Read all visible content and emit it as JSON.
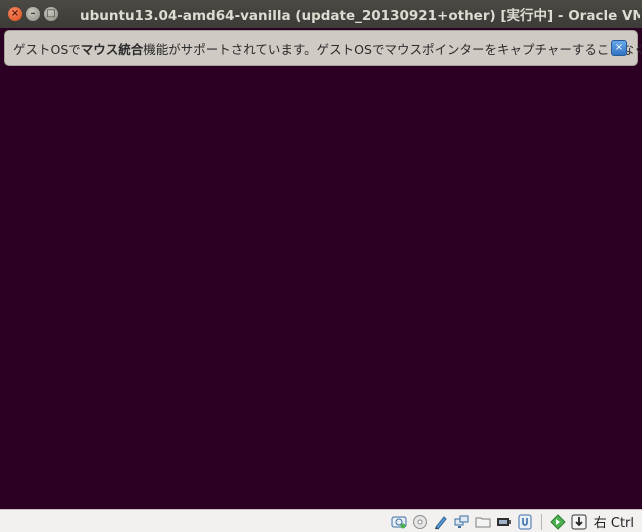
{
  "window": {
    "title": "ubuntu13.04-amd64-vanilla (update_20130921+other) [実行中] - Oracle VM V",
    "controls": {
      "close": "×",
      "minimize": "–",
      "maximize": "□"
    }
  },
  "banner": {
    "text_prefix": "ゲストOSで",
    "text_bold": "マウス統合",
    "text_suffix": "機能がサポートされています。ゲストOSでマウスポインターをキャプチャーすることなく",
    "close_glyph": "×"
  },
  "statusbar": {
    "icons": [
      "hard-disk-icon",
      "optical-drive-icon",
      "usb-pen-icon",
      "network-icon",
      "shared-folder-icon",
      "display-icon",
      "usb-device-icon",
      "mouse-integration-icon",
      "keyboard-capture-icon"
    ],
    "host_key_label": "右 Ctrl"
  },
  "colors": {
    "guest_screen": "#2c0022",
    "titlebar": "#3c3b37",
    "banner": "#cfcac3",
    "statusbar": "#f2f1f0"
  }
}
